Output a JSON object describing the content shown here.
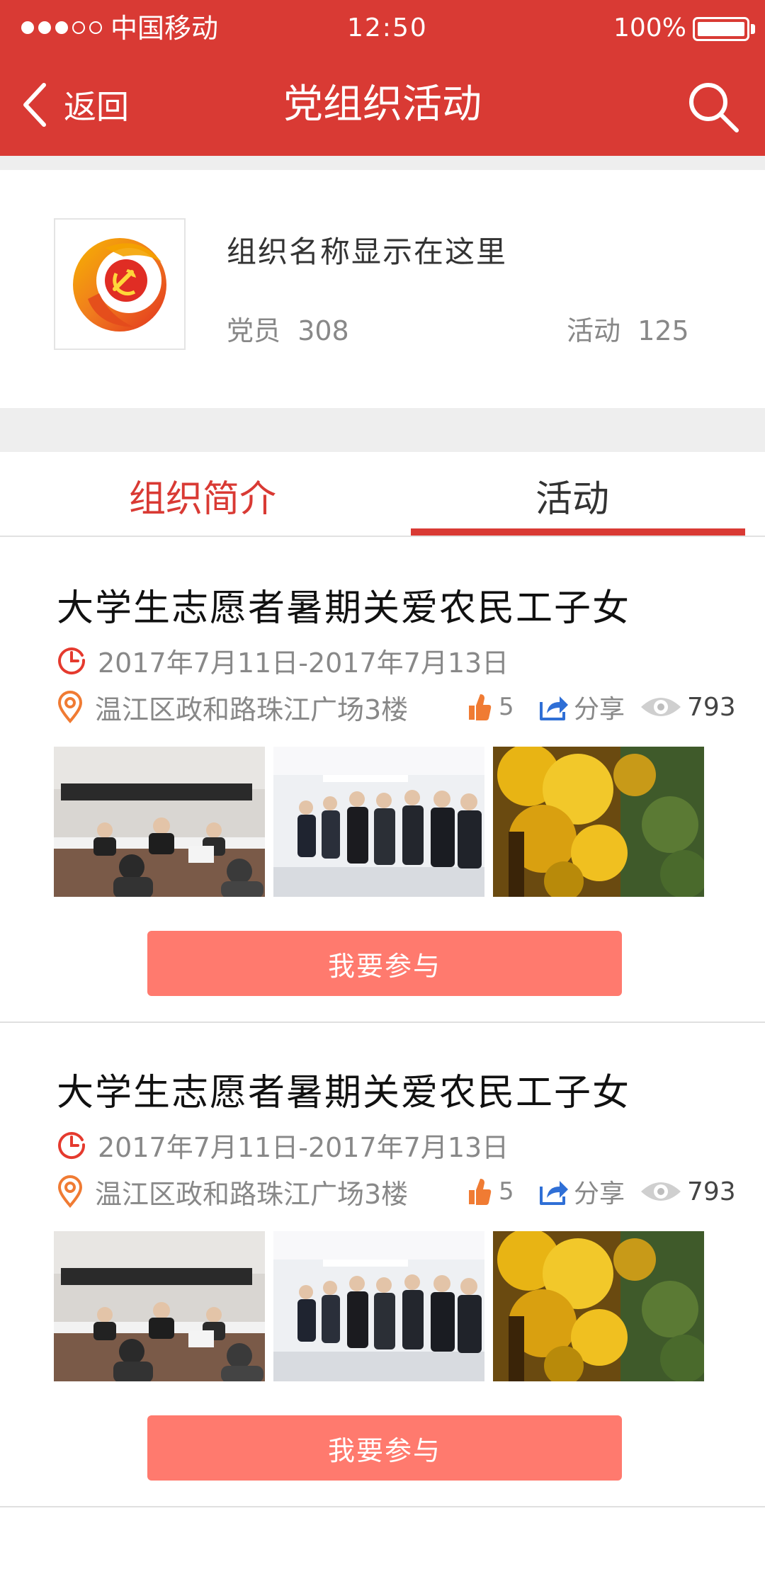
{
  "status_bar": {
    "carrier": "中国移动",
    "time": "12:50",
    "battery": "100%",
    "signal_filled": 3,
    "signal_total": 5
  },
  "nav": {
    "back_label": "返回",
    "title": "党组织活动",
    "icons": {
      "back": "chevron-left-icon",
      "search": "search-icon"
    }
  },
  "org": {
    "name": "组织名称显示在这里",
    "members_label": "党员",
    "members_count": "308",
    "activities_label": "活动",
    "activities_count": "125",
    "logo_icon": "party-emblem-logo"
  },
  "tabs": [
    {
      "label": "组织简介",
      "active": false
    },
    {
      "label": "活动",
      "active": true
    }
  ],
  "activities": [
    {
      "title": "大学生志愿者暑期关爱农民工子女",
      "date_range": "2017年7月11日-2017年7月13日",
      "location": "温江区政和路珠江广场3楼",
      "likes": "5",
      "share_label": "分享",
      "views": "793",
      "photos": [
        "meeting-photo",
        "visit-photo",
        "autumn-leaves-photo"
      ],
      "join_label": "我要参与"
    },
    {
      "title": "大学生志愿者暑期关爱农民工子女",
      "date_range": "2017年7月11日-2017年7月13日",
      "location": "温江区政和路珠江广场3楼",
      "likes": "5",
      "share_label": "分享",
      "views": "793",
      "photos": [
        "meeting-photo",
        "visit-photo",
        "autumn-leaves-photo"
      ],
      "join_label": "我要参与"
    }
  ],
  "colors": {
    "brand_red": "#d93a34",
    "join_button": "#ff7a6e",
    "icon_orange": "#f07b33",
    "share_blue": "#2f6fd6",
    "muted_text": "#888888"
  }
}
